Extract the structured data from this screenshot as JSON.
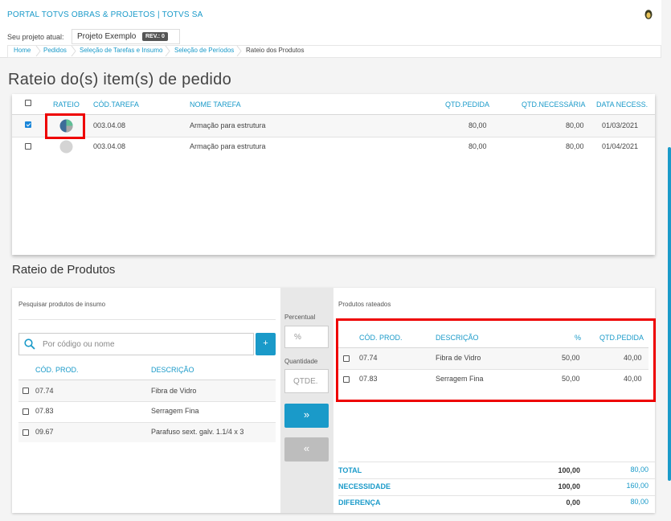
{
  "header": {
    "portal_title": "PORTAL TOTVS OBRAS & PROJETOS | TOTVS SA",
    "project_label": "Seu projeto atual:",
    "project_name": "Projeto Exemplo",
    "rev_badge": "REV.: 0"
  },
  "breadcrumb": [
    "Home",
    "Pedidos",
    "Seleção de Tarefas e Insumo",
    "Seleção de Períodos",
    "Rateio dos Produtos"
  ],
  "page_title": "Rateio do(s) item(s) de pedido",
  "items_table": {
    "headers": [
      "RATEIO",
      "CÓD.TAREFA",
      "NOME TAREFA",
      "QTD.PEDIDA",
      "QTD.NECESSÁRIA",
      "DATA NECESS."
    ],
    "rows": [
      {
        "checked": true,
        "code": "003.04.08",
        "name": "Armação para estrutura",
        "qtd_pedida": "80,00",
        "qtd_necessaria": "80,00",
        "data": "01/03/2021"
      },
      {
        "checked": false,
        "code": "003.04.08",
        "name": "Armação para estrutura",
        "qtd_pedida": "80,00",
        "qtd_necessaria": "80,00",
        "data": "01/04/2021"
      }
    ]
  },
  "rateio_section": {
    "title": "Rateio de Produtos",
    "search_label": "Pesquisar produtos de insumo",
    "search_placeholder": "Por código ou nome",
    "add_button": "+",
    "search_headers": [
      "CÓD. PROD.",
      "DESCRIÇÃO"
    ],
    "search_rows": [
      {
        "code": "07.74",
        "desc": "Fibra de Vidro"
      },
      {
        "code": "07.83",
        "desc": "Serragem Fina"
      },
      {
        "code": "09.67",
        "desc": "Parafuso sext. galv. 1.1/4 x 3"
      }
    ],
    "percent_label": "Percentual",
    "percent_placeholder": "%",
    "qty_label": "Quantidade",
    "qty_placeholder": "QTDE.",
    "move_right": "»",
    "move_left": "«",
    "rated_label": "Produtos rateados",
    "rated_headers": [
      "CÓD. PROD.",
      "DESCRIÇÃO",
      "%",
      "QTD.PEDIDA"
    ],
    "rated_rows": [
      {
        "code": "07.74",
        "desc": "Fibra de Vidro",
        "pct": "50,00",
        "qtd": "40,00"
      },
      {
        "code": "07.83",
        "desc": "Serragem Fina",
        "pct": "50,00",
        "qtd": "40,00"
      }
    ],
    "totals": [
      {
        "label": "TOTAL",
        "value": "100,00",
        "value2": "80,00"
      },
      {
        "label": "NECESSIDADE",
        "value": "100,00",
        "value2": "160,00"
      },
      {
        "label": "DIFERENÇA",
        "value": "0,00",
        "value2": "80,00"
      }
    ]
  },
  "colors": {
    "accent": "#1a9ac9",
    "highlight": "#e00000"
  }
}
